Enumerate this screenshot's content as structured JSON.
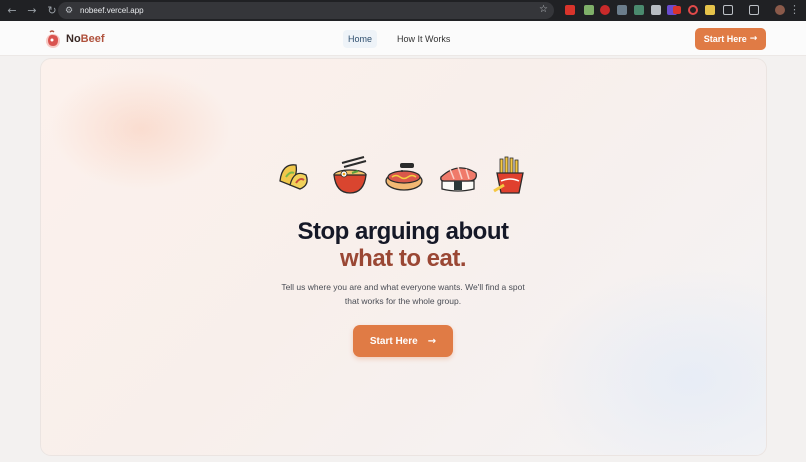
{
  "browser": {
    "url": "nobeef.vercel.app",
    "back_icon": "arrow-left-icon",
    "forward_icon": "arrow-right-icon",
    "reload_icon": "reload-icon"
  },
  "header": {
    "logo_no": "No",
    "logo_beef": "Beef",
    "nav": {
      "home": "Home",
      "how": "How It Works"
    },
    "cta": "Start Here"
  },
  "hero": {
    "headline_line1": "Stop arguing about",
    "headline_line2": "what to eat.",
    "subtext": "Tell us where you are and what everyone wants. We'll find a spot that works for the whole group.",
    "cta": "Start Here",
    "foods": [
      "taco-icon",
      "ramen-icon",
      "hot-dog-icon",
      "sushi-icon",
      "fries-icon"
    ]
  },
  "colors": {
    "accent": "#e07b45",
    "headline": "#151827",
    "headline_accent": "#9a4734"
  }
}
